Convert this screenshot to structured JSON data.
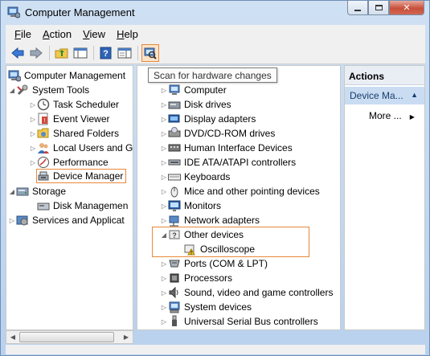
{
  "window": {
    "title": "Computer Management"
  },
  "menu": [
    {
      "pre": "",
      "ul": "F",
      "post": "ile"
    },
    {
      "pre": "",
      "ul": "A",
      "post": "ction"
    },
    {
      "pre": "",
      "ul": "V",
      "post": "iew"
    },
    {
      "pre": "",
      "ul": "H",
      "post": "elp"
    }
  ],
  "toolbar": {
    "icons": [
      "back-arrow-icon",
      "forward-arrow-icon",
      "up-folder-icon",
      "show-hide-tree-icon",
      "help-icon",
      "properties-icon",
      "scan-hardware-icon"
    ],
    "tooltip": "Scan for hardware changes"
  },
  "left_tree": [
    {
      "label": "Computer Management",
      "arrow": "",
      "icon": "computer-management-icon"
    },
    {
      "label": "System Tools",
      "arrow": "▲",
      "icon": "tools-icon"
    },
    {
      "label": "Task Scheduler",
      "arrow": "▷",
      "icon": "clock-icon"
    },
    {
      "label": "Event Viewer",
      "arrow": "▷",
      "icon": "event-viewer-icon"
    },
    {
      "label": "Shared Folders",
      "arrow": "▷",
      "icon": "shared-folder-icon"
    },
    {
      "label": "Local Users and G",
      "arrow": "▷",
      "icon": "users-icon"
    },
    {
      "label": "Performance",
      "arrow": "▷",
      "icon": "performance-icon"
    },
    {
      "label": "Device Manager",
      "arrow": "",
      "icon": "device-manager-icon"
    },
    {
      "label": "Storage",
      "arrow": "▲",
      "icon": "storage-icon"
    },
    {
      "label": "Disk Managemen",
      "arrow": "",
      "icon": "disk-icon"
    },
    {
      "label": "Services and Applicat",
      "arrow": "▷",
      "icon": "services-icon"
    }
  ],
  "device_tree": [
    {
      "label": "Computer",
      "arrow": "▷",
      "icon": "computer-icon"
    },
    {
      "label": "Disk drives",
      "arrow": "▷",
      "icon": "disk-drive-icon"
    },
    {
      "label": "Display adapters",
      "arrow": "▷",
      "icon": "display-adapter-icon"
    },
    {
      "label": "DVD/CD-ROM drives",
      "arrow": "▷",
      "icon": "dvd-icon"
    },
    {
      "label": "Human Interface Devices",
      "arrow": "▷",
      "icon": "hid-icon"
    },
    {
      "label": "IDE ATA/ATAPI controllers",
      "arrow": "▷",
      "icon": "ide-controller-icon"
    },
    {
      "label": "Keyboards",
      "arrow": "▷",
      "icon": "keyboard-icon"
    },
    {
      "label": "Mice and other pointing devices",
      "arrow": "▷",
      "icon": "mouse-icon"
    },
    {
      "label": "Monitors",
      "arrow": "▷",
      "icon": "monitor-icon"
    },
    {
      "label": "Network adapters",
      "arrow": "▷",
      "icon": "network-adapter-icon"
    },
    {
      "label": "Other devices",
      "arrow": "◢",
      "icon": "unknown-device-icon"
    },
    {
      "label": "Oscilloscope",
      "arrow": "",
      "icon": "warning-device-icon"
    },
    {
      "label": "Ports (COM & LPT)",
      "arrow": "▷",
      "icon": "port-icon"
    },
    {
      "label": "Processors",
      "arrow": "▷",
      "icon": "processor-icon"
    },
    {
      "label": "Sound, video and game controllers",
      "arrow": "▷",
      "icon": "sound-icon"
    },
    {
      "label": "System devices",
      "arrow": "▷",
      "icon": "system-device-icon"
    },
    {
      "label": "Universal Serial Bus controllers",
      "arrow": "▷",
      "icon": "usb-icon"
    }
  ],
  "actions": {
    "header": "Actions",
    "section": "Device Ma...",
    "more": "More ..."
  }
}
